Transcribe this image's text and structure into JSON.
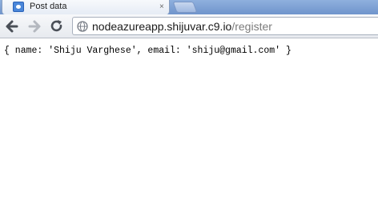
{
  "tab": {
    "title": "Post data",
    "close_label": "×",
    "favicon": "page-icon"
  },
  "toolbar": {
    "back_icon": "arrow-left-icon",
    "forward_icon": "arrow-right-icon",
    "reload_icon": "reload-icon"
  },
  "address_bar": {
    "host": "nodeazureapp.shijuvar.c9.io",
    "path": "/register",
    "icon": "globe-icon"
  },
  "page": {
    "body_text": "{ name: 'Shiju Varghese', email: 'shiju@gmail.com' }"
  },
  "colors": {
    "tabstrip": "#8fb0de",
    "url_host": "#1a1a1a",
    "url_path": "#7b7b7b"
  }
}
